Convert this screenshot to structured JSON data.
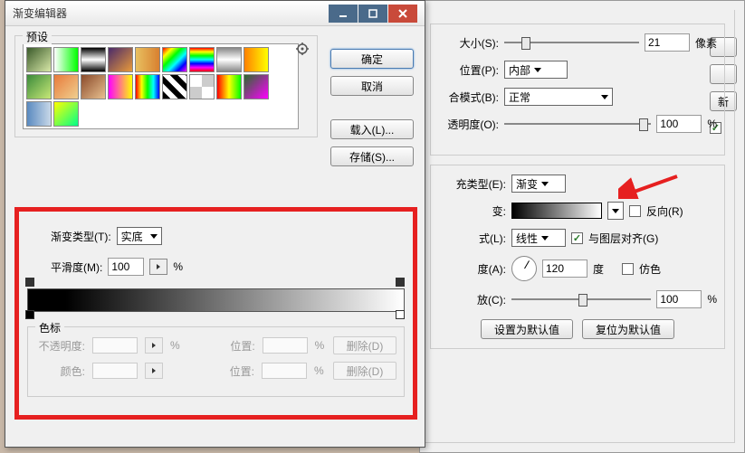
{
  "dialog": {
    "title": "渐变编辑器",
    "presets_label": "预设",
    "buttons": {
      "ok": "确定",
      "cancel": "取消",
      "load": "载入(L)...",
      "save": "存储(S)...",
      "new": "新建(W)"
    },
    "gradient": {
      "type_label": "渐变类型(T):",
      "type_value": "实底",
      "smooth_label": "平滑度(M):",
      "smooth_value": "100",
      "smooth_unit": "%",
      "stops_label": "色标",
      "opacity_label": "不透明度:",
      "opacity_unit": "%",
      "position_label": "位置:",
      "position_unit": "%",
      "delete_label": "删除(D)",
      "color_label": "颜色:"
    }
  },
  "layer": {
    "size_label": "大小(S):",
    "size_value": "21",
    "size_unit": "像素",
    "position_label": "位置(P):",
    "position_value": "内部",
    "blend_label": "合模式(B):",
    "blend_value": "正常",
    "opacity_label": "透明度(O):",
    "opacity_value": "100",
    "opacity_unit": "%",
    "filltype_label": "充类型(E):",
    "filltype_value": "渐变",
    "gradient_label": "变:",
    "reverse_label": "反向(R)",
    "style_label": "式(L):",
    "style_value": "线性",
    "align_label": "与图层对齐(G)",
    "angle_label": "度(A):",
    "angle_value": "120",
    "angle_unit": "度",
    "dither_label": "仿色",
    "scale_label": "放(C):",
    "scale_value": "100",
    "scale_unit": "%",
    "default_btn": "设置为默认值",
    "reset_btn": "复位为默认值",
    "new_style": "新"
  },
  "swatches": [
    "linear-gradient(135deg,#3a5a2a,#d8e8a8)",
    "linear-gradient(to right,rgba(0,255,0,0),#00ff00)",
    "linear-gradient(#000,#fff,#000)",
    "linear-gradient(135deg,#4a2a6a,#e89a3a)",
    "linear-gradient(to right,#e8c060,#d88030)",
    "linear-gradient(135deg,#ff0000,#ffff00,#00ff00,#00ffff,#0000ff,#ff00ff)",
    "linear-gradient(to bottom,#ff0000,#ffff00,#00ff00,#00ffff,#0000ff,#ff00ff,#ff0000)",
    "linear-gradient(to bottom,#888,#fff,#888)",
    "linear-gradient(to right,#ff8000,#ffff00)",
    "linear-gradient(135deg,#3a8a3a,#c8e878)",
    "linear-gradient(135deg,#e87a3a,#f0d090)",
    "linear-gradient(135deg,#8a4a2a,#e8c090)",
    "linear-gradient(to right,#ff00ff,#ffff00)",
    "linear-gradient(to right,#ff0000,#ffff00,#00ff00,#00ffff,#0000ff)",
    "repeating-linear-gradient(45deg,#000 0 6px,#fff 6px 12px)",
    "repeating-conic-gradient(#ccc 0 25%,#fff 0 50%)",
    "linear-gradient(to right,#ff0000,#ffff00,#00ff00)",
    "linear-gradient(135deg,#2a6a2a,#ff00ff)",
    "linear-gradient(to right,#5a8ac0,#c8d8e8)",
    "linear-gradient(135deg,#ffff00,#00ff88)"
  ]
}
